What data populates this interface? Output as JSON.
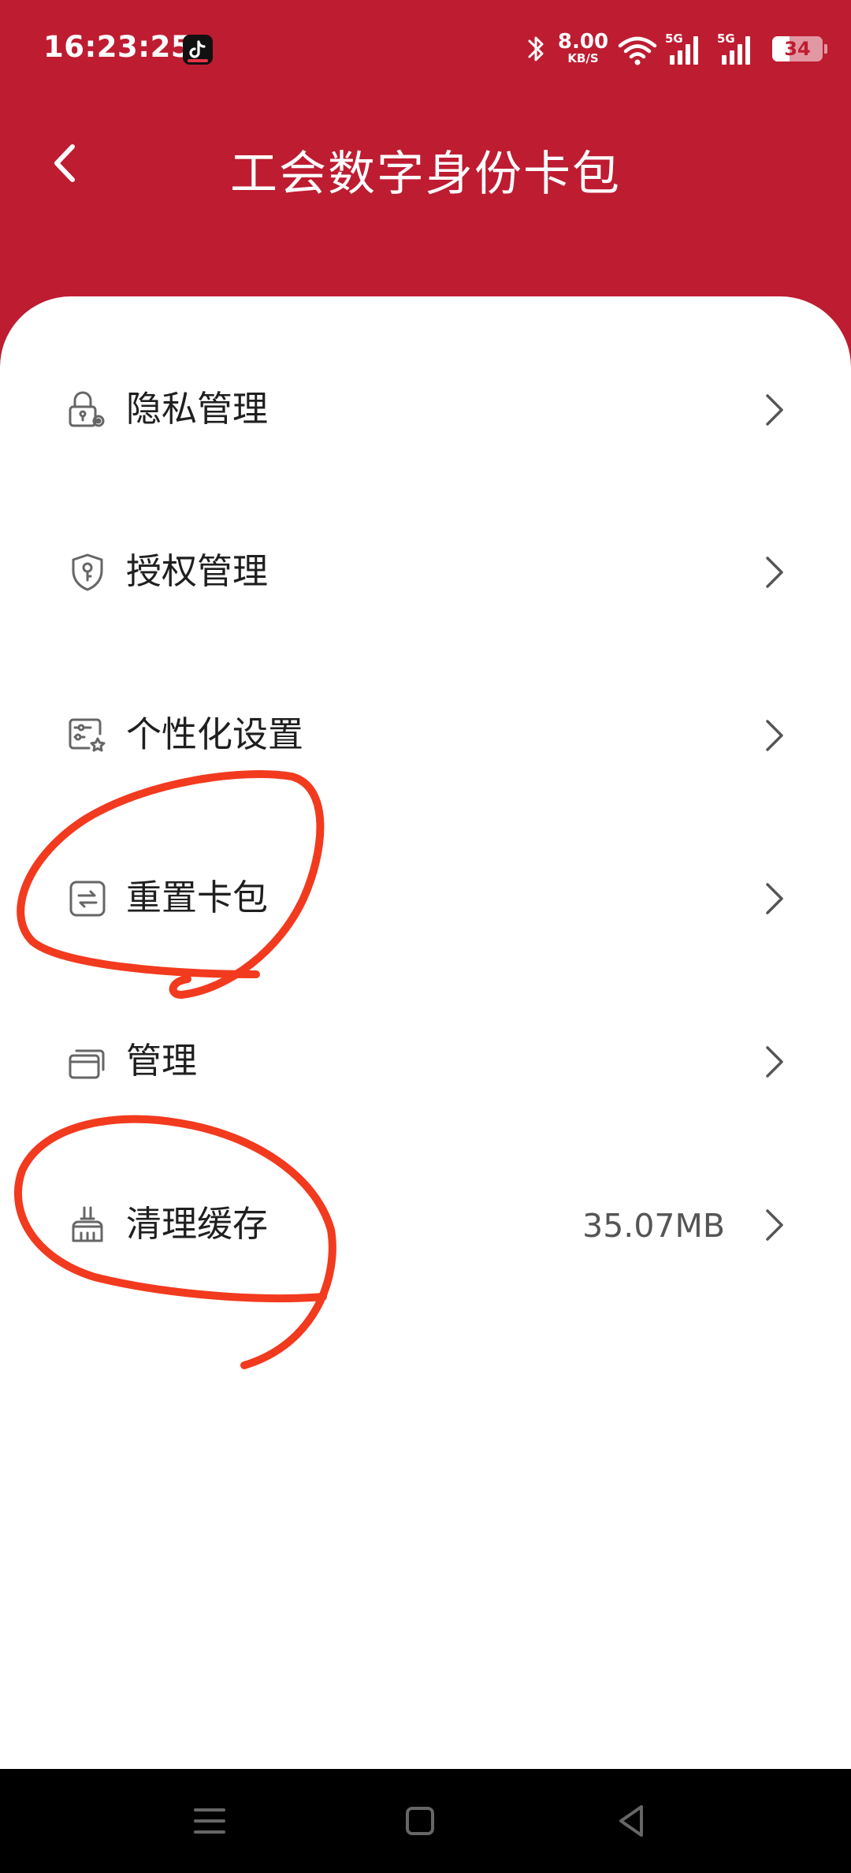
{
  "status_bar": {
    "time": "16:23:25",
    "net_speed_value": "8.00",
    "net_speed_unit": "KB/S",
    "signal_1": "5G",
    "signal_2": "5G",
    "battery": "34",
    "battery_level": 0.34
  },
  "header": {
    "title": "工会数字身份卡包"
  },
  "menu": {
    "items": [
      {
        "label": "隐私管理",
        "icon": "lock-gear-icon",
        "value": ""
      },
      {
        "label": "授权管理",
        "icon": "shield-key-icon",
        "value": ""
      },
      {
        "label": "个性化设置",
        "icon": "settings-star-icon",
        "value": ""
      },
      {
        "label": "重置卡包",
        "icon": "reset-arrows-icon",
        "value": ""
      },
      {
        "label": "管理",
        "icon": "cards-stack-icon",
        "value": ""
      },
      {
        "label": "清理缓存",
        "icon": "broom-icon",
        "value": "35.07MB"
      }
    ]
  },
  "colors": {
    "brand_red": "#be1c31",
    "annotation_red": "#f23a1e",
    "text": "#1f1f1f",
    "icon_gray": "#666666"
  },
  "bottom_nav": {
    "icons": [
      "menu-lines-icon",
      "home-square-icon",
      "back-triangle-icon"
    ]
  }
}
